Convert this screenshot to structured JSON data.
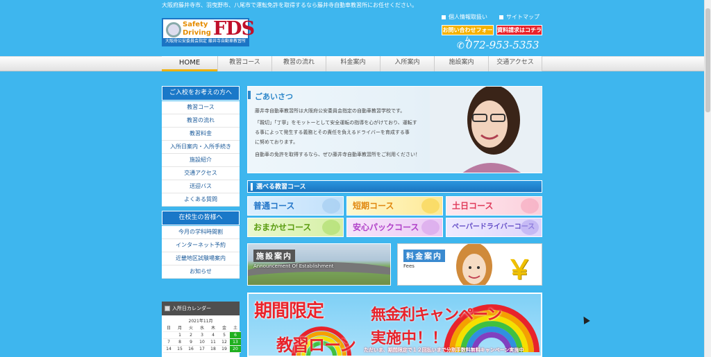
{
  "header": {
    "tagline": "大阪府藤井寺市、羽曳野市、八尾市で運転免許を取得するなら藤井寺自動車教習所にお任せください。",
    "logo": {
      "line1": "Safety",
      "line2": "Driving",
      "mark": "FDS",
      "sub": "大阪府公安委員会指定 藤井寺自動車教習所"
    },
    "privacy_link": "個人情報取扱い",
    "sitemap_link": "サイトマップ",
    "contact_button": "お問い合わせフォーム",
    "document_button": "資料請求はコチラ",
    "phone": "072-953-5353"
  },
  "nav": [
    "HOME",
    "教習コース",
    "教習の流れ",
    "料金案内",
    "入所案内",
    "施設案内",
    "交通アクセス"
  ],
  "sidebar": {
    "prospective_title": "ご入校をお考えの方へ",
    "prospective_items": [
      "教習コース",
      "教習の流れ",
      "教習料金",
      "入所日案内・入所手続き",
      "施設紹介",
      "交通アクセス",
      "送迎バス",
      "よくある質問"
    ],
    "current_title": "在校生の皆様へ",
    "current_items": [
      "今月の学科時間割",
      "インターネット予約",
      "近畿地区試験場案内",
      "お知らせ"
    ],
    "calendar": {
      "title": "入所日カレンダー",
      "month": "2021年11月",
      "weekdays": [
        "日",
        "月",
        "火",
        "水",
        "木",
        "金",
        "土"
      ],
      "days": [
        "",
        "1",
        "2",
        "3",
        "4",
        "5",
        "6",
        "7",
        "8",
        "9",
        "10",
        "11",
        "12",
        "13",
        "14",
        "15",
        "16",
        "17",
        "18",
        "19",
        "20"
      ],
      "highlight_color": "#1fb01f"
    }
  },
  "greeting": {
    "title": "ごあいさつ",
    "line1": "藤井寺自動車教習所は大阪府公安委員会指定の自動車教習学校です。",
    "line2": "「親切」「丁寧」をモットーとして安全運転の指導を心がけており、運転す",
    "line3": "る事によって発生する義務とその責任を負えるドライバーを育成する事",
    "line4": "に努めております。",
    "line5": "自動車の免許を取得するなら、ぜひ藤井寺自動車教習所をご利用ください！"
  },
  "courses": {
    "title": "選べる教習コース",
    "items": [
      "普通コース",
      "短期コース",
      "土日コース",
      "おまかせコース",
      "安心パックコース",
      "ペーパードライバーコース"
    ]
  },
  "facility": {
    "title": "施設案内",
    "subtitle": "Announcement Of Establishment"
  },
  "fees": {
    "title": "料金案内",
    "subtitle": "Fees",
    "symbol": "￥"
  },
  "campaign": {
    "line1": "期間限定",
    "line2": "教習ローン",
    "line3": "無金利キャンペーン",
    "line4": "実施中！！",
    "note": "ただいま、期間限定で１２回払いまで分割手数料無料キャンペーン実施中"
  },
  "colors": {
    "background": "#3eb6ee",
    "accent": "#1a78c8",
    "contact": "#f5b200",
    "document": "#e8232b"
  }
}
